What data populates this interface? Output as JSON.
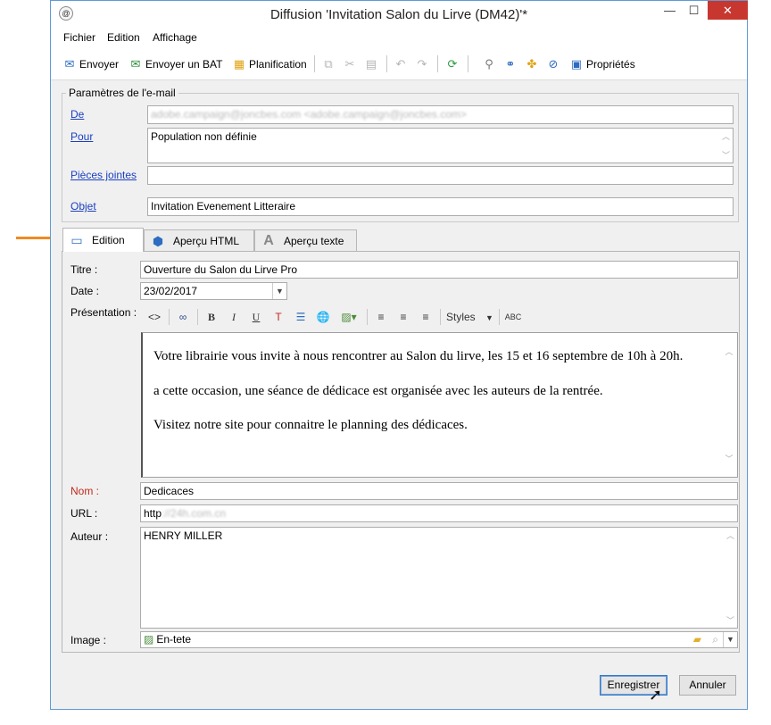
{
  "window": {
    "title": "Diffusion 'Invitation Salon du Lirve (DM42)'*",
    "app_icon": "@"
  },
  "window_controls": {
    "minimize": "—",
    "maximize": "☐",
    "close": "✕"
  },
  "menu": [
    "Fichier",
    "Edition",
    "Affichage"
  ],
  "toolbar": {
    "send": "Envoyer",
    "send_proof": "Envoyer un BAT",
    "planning": "Planification",
    "properties": "Propriétés"
  },
  "email_params": {
    "group_title": "Paramètres de l'e-mail",
    "from_label": "De",
    "from_value": "adobe.campaign@joncbes.com <adobe.campaign@joncbes.com>",
    "to_label": "Pour",
    "to_value": "Population non définie",
    "attachments_label": "Pièces jointes",
    "attachments_value": "",
    "subject_label": "Objet",
    "subject_value": "Invitation Evenement Litteraire"
  },
  "tabs": [
    {
      "label": "Edition"
    },
    {
      "label": "Aperçu HTML"
    },
    {
      "label": "Aperçu texte"
    }
  ],
  "form": {
    "titre_label": "Titre :",
    "titre_value": "Ouverture du Salon du Lirve Pro",
    "date_label": "Date :",
    "date_value": "23/02/2017",
    "presentation_label": "Présentation :",
    "styles_label": "Styles",
    "paragraphs": [
      "Votre librairie vous invite à nous rencontrer au Salon du lirve, les 15 et 16 septembre de 10h à 20h.",
      "a cette occasion, une séance de dédicace est organisée avec les auteurs de la rentrée.",
      "Visitez notre site pour connaitre le planning des dédicaces."
    ],
    "nom_label": "Nom :",
    "nom_value": "Dedicaces",
    "url_label": "URL :",
    "url_prefix": "http",
    "url_blurred": "://24h.com.cn",
    "auteur_label": "Auteur :",
    "auteur_value": "HENRY MILLER",
    "image_label": "Image :",
    "image_value": "En-tete"
  },
  "buttons": {
    "save": "Enregistrer",
    "cancel": "Annuler"
  },
  "colors": {
    "accent_arrow": "#f08a22",
    "link": "#1a3fc0",
    "required_label": "#c0281c",
    "close_button": "#c7372f"
  }
}
